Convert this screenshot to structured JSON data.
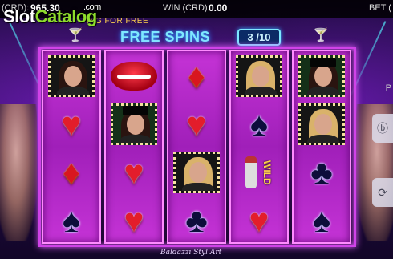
{
  "brand": {
    "part1": "Slot",
    "part2": "Catalog",
    "suffix": ".com"
  },
  "topbar": {
    "credit_label": "(CRD):",
    "credit_value": "965.30",
    "win_label": "WIN (CRD):",
    "win_value": "0.00",
    "bet_label": "BET ("
  },
  "status_text": "ING FOR FREE",
  "free_spins": {
    "title": "FREE SPINS",
    "counter": "3 /10"
  },
  "reels": [
    [
      {
        "symbol": "portrait-brunette",
        "glyph": ""
      },
      {
        "symbol": "heart",
        "glyph": "♥"
      },
      {
        "symbol": "diamond",
        "glyph": "♦"
      },
      {
        "symbol": "spade",
        "glyph": "♠"
      }
    ],
    [
      {
        "symbol": "lips",
        "glyph": ""
      },
      {
        "symbol": "portrait-hat",
        "glyph": ""
      },
      {
        "symbol": "heart",
        "glyph": "♥"
      },
      {
        "symbol": "heart",
        "glyph": "♥"
      }
    ],
    [
      {
        "symbol": "diamond",
        "glyph": "♦"
      },
      {
        "symbol": "heart",
        "glyph": "♥"
      },
      {
        "symbol": "portrait-blonde",
        "glyph": ""
      },
      {
        "symbol": "club",
        "glyph": "♣"
      }
    ],
    [
      {
        "symbol": "portrait-blonde",
        "glyph": ""
      },
      {
        "symbol": "spade",
        "glyph": "♠"
      },
      {
        "symbol": "wild",
        "glyph": "WILD"
      },
      {
        "symbol": "heart",
        "glyph": "♥"
      }
    ],
    [
      {
        "symbol": "portrait-hat",
        "glyph": ""
      },
      {
        "symbol": "portrait-blonde",
        "glyph": ""
      },
      {
        "symbol": "club",
        "glyph": "♣"
      },
      {
        "symbol": "spade",
        "glyph": "♠"
      }
    ]
  ],
  "footer_signature": "Baldazzi Styl Art",
  "side_buttons": {
    "paytable_icon": "info-icon",
    "refresh_icon": "refresh-icon",
    "p_label": "P"
  },
  "colors": {
    "frame": "#d042e8",
    "title": "#7ee8ff",
    "brand_green": "#8ddc2c"
  }
}
